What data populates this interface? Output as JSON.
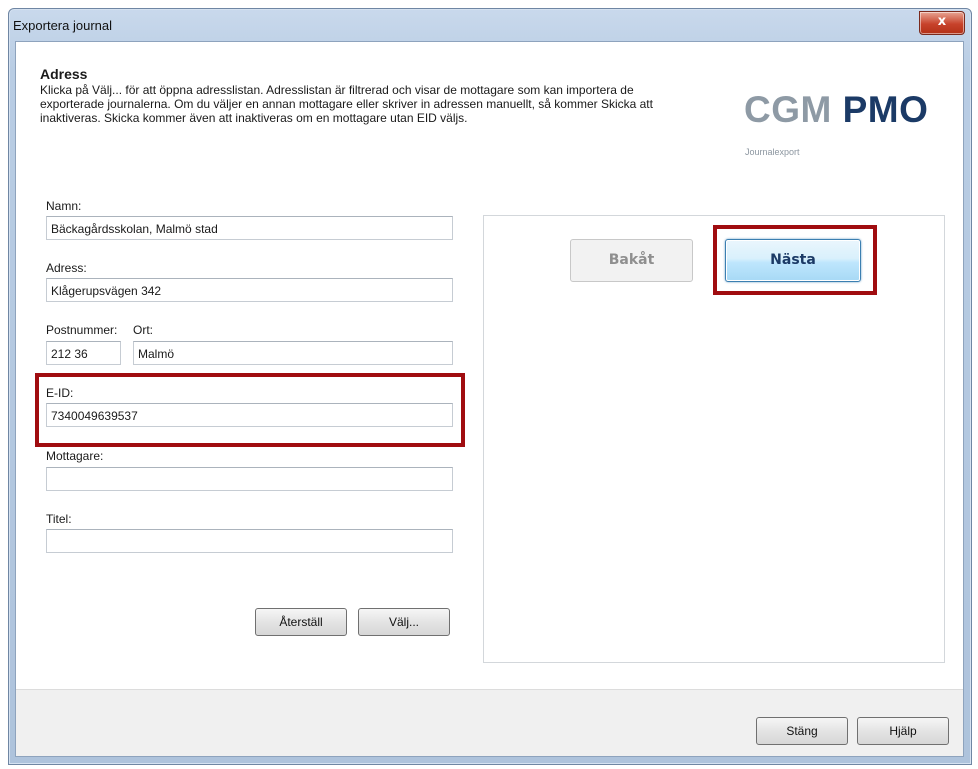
{
  "window": {
    "title": "Exportera journal",
    "close_label": "x"
  },
  "header": {
    "title": "Adress",
    "description": "Klicka på Välj... för att öppna adresslistan. Adresslistan är filtrerad och visar de mottagare som kan importera de exporterade journalerna. Om du väljer en annan mottagare eller skriver in adressen manuellt, så kommer Skicka att inaktiveras. Skicka kommer även att inaktiveras om en mottagare utan EID väljs."
  },
  "logo": {
    "part1": "CGM",
    "part2": "PMO",
    "subtitle": "Journalexport"
  },
  "form": {
    "namn": {
      "label": "Namn:",
      "value": "Bäckagårdsskolan, Malmö stad"
    },
    "adress": {
      "label": "Adress:",
      "value": "Klågerupsvägen 342"
    },
    "postnummer": {
      "label": "Postnummer:",
      "value": "212 36"
    },
    "ort": {
      "label": "Ort:",
      "value": "Malmö"
    },
    "eid": {
      "label": "E-ID:",
      "value": "7340049639537"
    },
    "mottagare": {
      "label": "Mottagare:",
      "value": ""
    },
    "titel": {
      "label": "Titel:",
      "value": ""
    },
    "reset_label": "Återställ",
    "choose_label": "Välj..."
  },
  "wizard": {
    "back_label": "Bakåt",
    "next_label": "Nästa"
  },
  "footer": {
    "close_label": "Stäng",
    "help_label": "Hjälp"
  },
  "colors": {
    "highlight": "#a00d10",
    "logo_gray": "#8e9aa5",
    "logo_navy": "#1b3a66"
  }
}
